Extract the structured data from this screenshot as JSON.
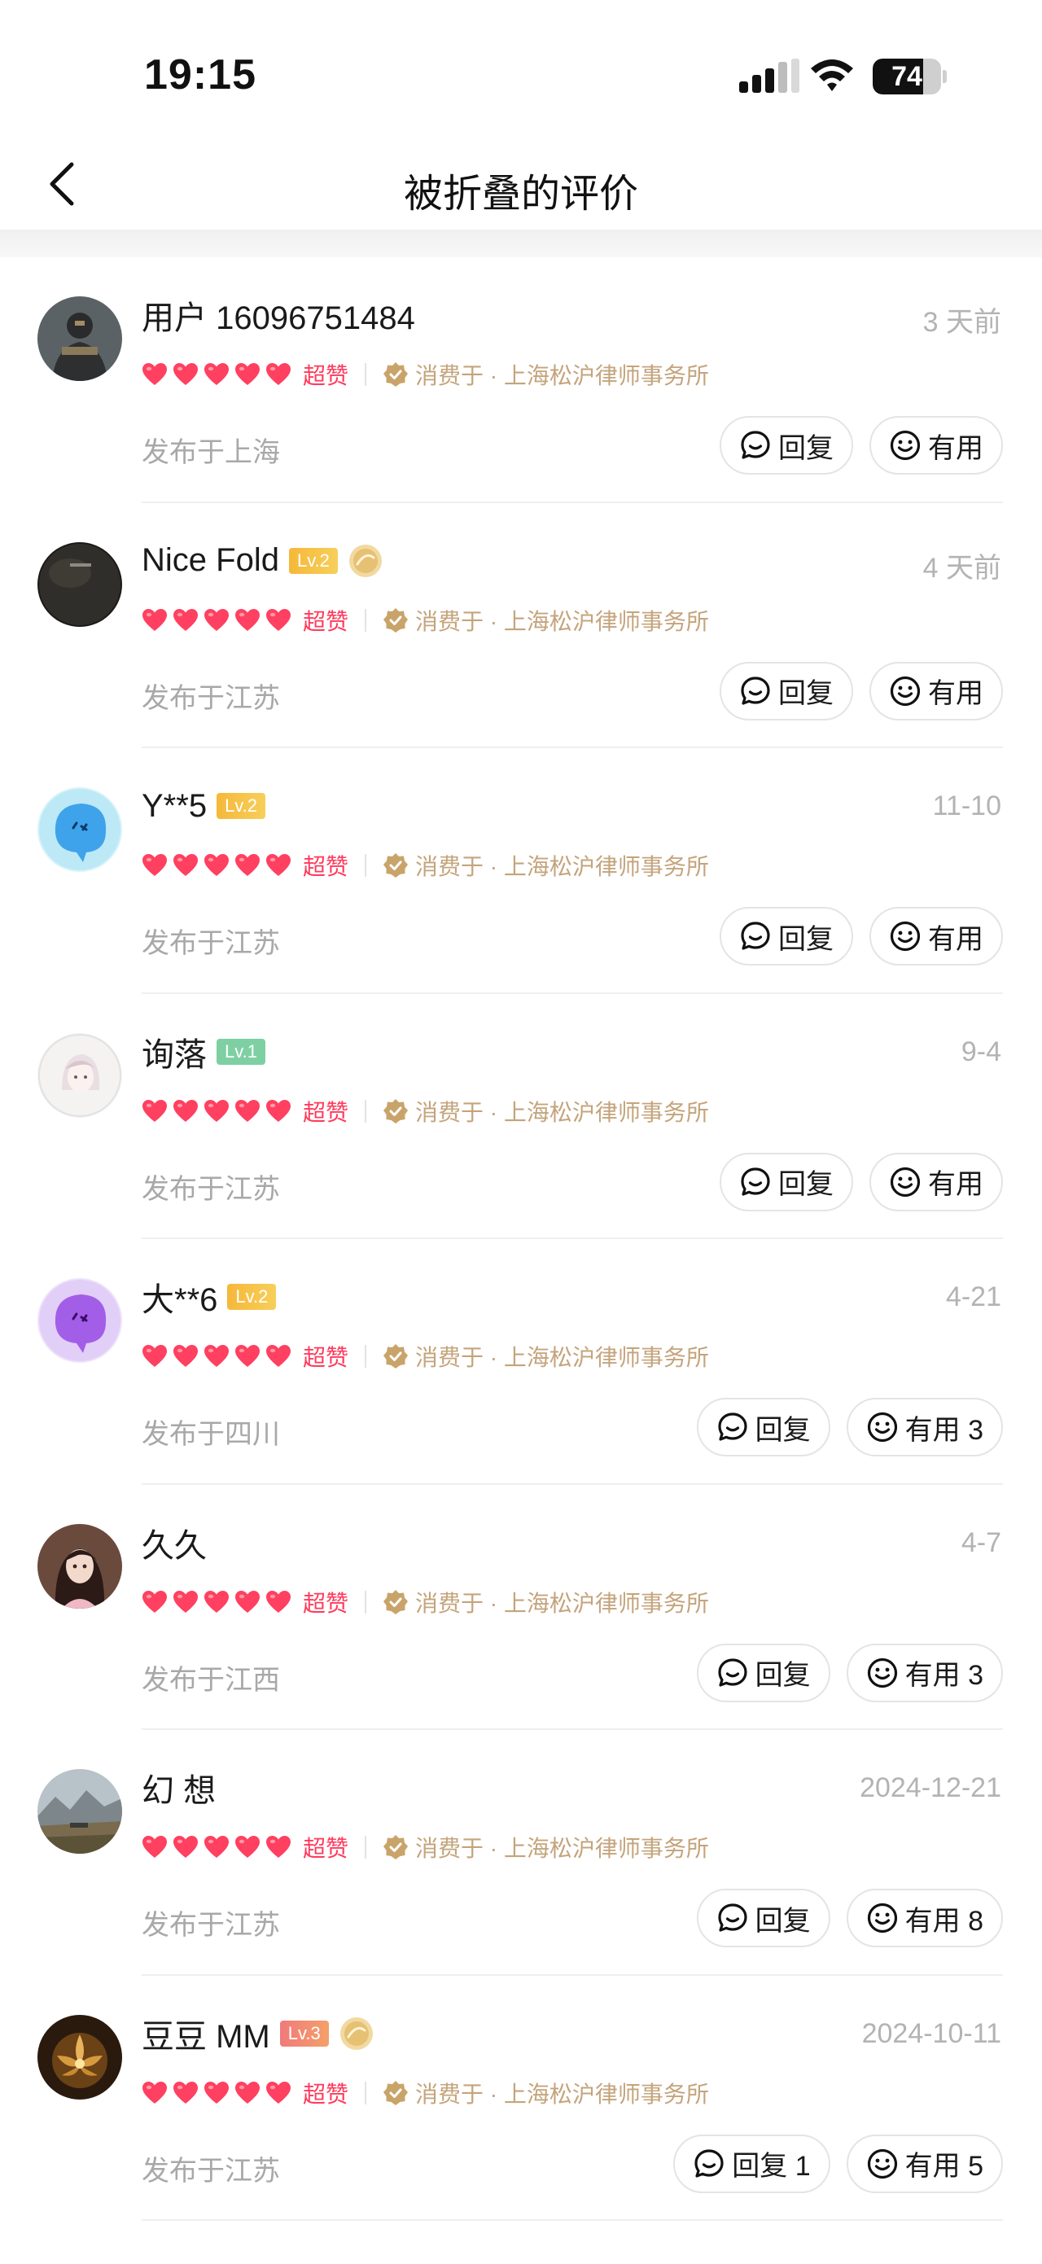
{
  "status_bar": {
    "time": "19:15",
    "battery": "74",
    "battery_level": 0.74
  },
  "nav": {
    "title": "被折叠的评价"
  },
  "colors": {
    "accent_red": "#ff3b5c",
    "gold_text": "#c4a47c",
    "muted": "#a8a8a8"
  },
  "reviews": [
    {
      "name": "用户 16096751484",
      "level": "",
      "level_class": "",
      "medal": false,
      "time": "3 天前",
      "rating_label": "超赞",
      "consumed": "消费于 · 上海松沪律师事务所",
      "location": "发布于上海",
      "reply_label": "回复",
      "useful_label": "有用",
      "avatar": "dark-figure"
    },
    {
      "name": "Nice Fold",
      "level": "Lv.2",
      "level_class": "lv2",
      "medal": true,
      "time": "4 天前",
      "rating_label": "超赞",
      "consumed": "消费于 · 上海松沪律师事务所",
      "location": "发布于江苏",
      "reply_label": "回复",
      "useful_label": "有用",
      "avatar": "black-circle"
    },
    {
      "name": "Y**5",
      "level": "Lv.2",
      "level_class": "lv2",
      "medal": false,
      "time": "11-10",
      "rating_label": "超赞",
      "consumed": "消费于 · 上海松沪律师事务所",
      "location": "发布于江苏",
      "reply_label": "回复",
      "useful_label": "有用",
      "avatar": "blue-blob"
    },
    {
      "name": "询落",
      "level": "Lv.1",
      "level_class": "lv1",
      "medal": false,
      "time": "9-4",
      "rating_label": "超赞",
      "consumed": "消费于 · 上海松沪律师事务所",
      "location": "发布于江苏",
      "reply_label": "回复",
      "useful_label": "有用",
      "avatar": "anime-girl"
    },
    {
      "name": "大**6",
      "level": "Lv.2",
      "level_class": "lv2",
      "medal": false,
      "time": "4-21",
      "rating_label": "超赞",
      "consumed": "消费于 · 上海松沪律师事务所",
      "location": "发布于四川",
      "reply_label": "回复",
      "useful_label": "有用 3",
      "avatar": "purple-blob"
    },
    {
      "name": "久久",
      "level": "",
      "level_class": "",
      "medal": false,
      "time": "4-7",
      "rating_label": "超赞",
      "consumed": "消费于 · 上海松沪律师事务所",
      "location": "发布于江西",
      "reply_label": "回复",
      "useful_label": "有用 3",
      "avatar": "portrait-girl"
    },
    {
      "name": "幻 想",
      "level": "",
      "level_class": "",
      "medal": false,
      "time": "2024-12-21",
      "rating_label": "超赞",
      "consumed": "消费于 · 上海松沪律师事务所",
      "location": "发布于江苏",
      "reply_label": "回复",
      "useful_label": "有用 8",
      "avatar": "landscape"
    },
    {
      "name": "豆豆 MM",
      "level": "Lv.3",
      "level_class": "lv3",
      "medal": true,
      "time": "2024-10-11",
      "rating_label": "超赞",
      "consumed": "消费于 · 上海松沪律师事务所",
      "location": "发布于江苏",
      "reply_label": "回复 1",
      "useful_label": "有用 5",
      "avatar": "golden-flower"
    }
  ]
}
